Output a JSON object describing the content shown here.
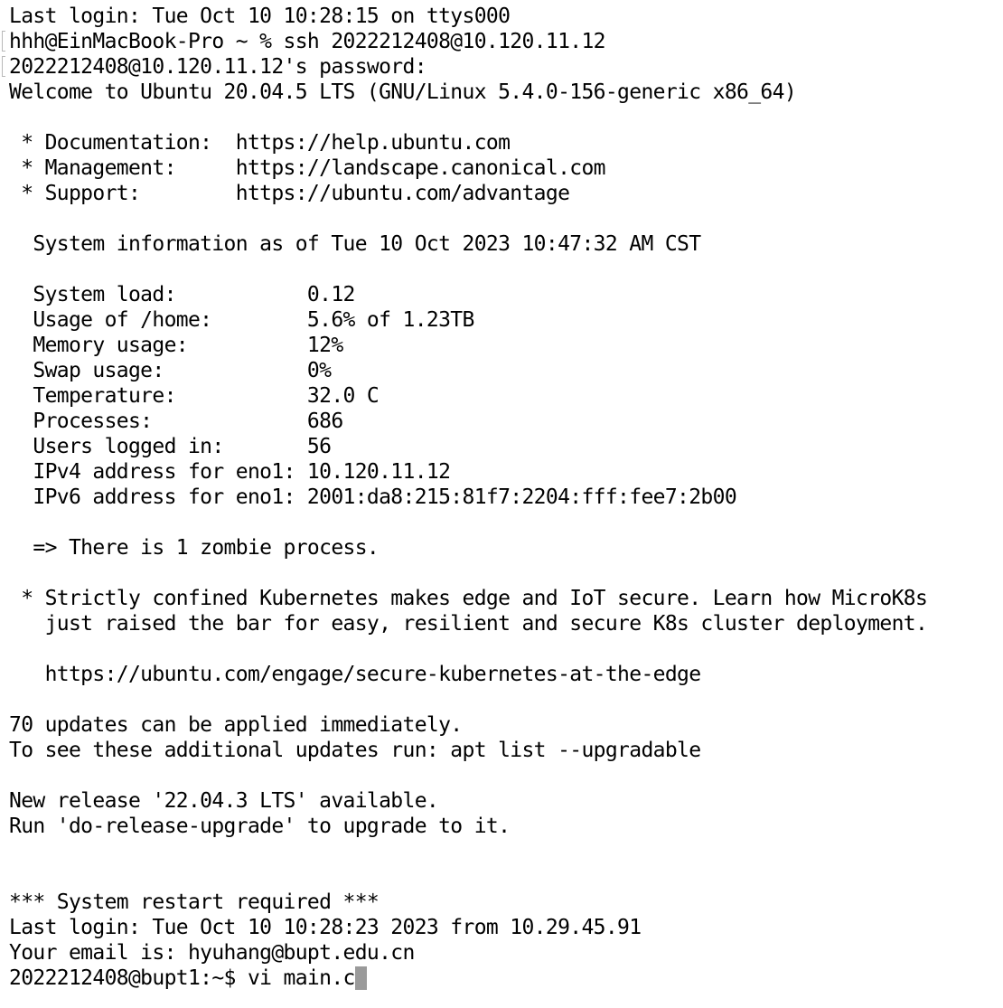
{
  "terminal": {
    "lines": [
      "Last login: Tue Oct 10 10:28:15 on ttys000",
      "hhh@EinMacBook-Pro ~ % ssh 2022212408@10.120.11.12",
      "2022212408@10.120.11.12's password:",
      "Welcome to Ubuntu 20.04.5 LTS (GNU/Linux 5.4.0-156-generic x86_64)",
      "",
      " * Documentation:  https://help.ubuntu.com",
      " * Management:     https://landscape.canonical.com",
      " * Support:        https://ubuntu.com/advantage",
      "",
      "  System information as of Tue 10 Oct 2023 10:47:32 AM CST",
      "",
      "  System load:           0.12",
      "  Usage of /home:        5.6% of 1.23TB",
      "  Memory usage:          12%",
      "  Swap usage:            0%",
      "  Temperature:           32.0 C",
      "  Processes:             686",
      "  Users logged in:       56",
      "  IPv4 address for eno1: 10.120.11.12",
      "  IPv6 address for eno1: 2001:da8:215:81f7:2204:fff:fee7:2b00",
      "",
      "  => There is 1 zombie process.",
      "",
      " * Strictly confined Kubernetes makes edge and IoT secure. Learn how MicroK8s",
      "   just raised the bar for easy, resilient and secure K8s cluster deployment.",
      "",
      "   https://ubuntu.com/engage/secure-kubernetes-at-the-edge",
      "",
      "70 updates can be applied immediately.",
      "To see these additional updates run: apt list --upgradable",
      "",
      "New release '22.04.3 LTS' available.",
      "Run 'do-release-upgrade' to upgrade to it.",
      "",
      "",
      "*** System restart required ***",
      "Last login: Tue Oct 10 10:28:23 2023 from 10.29.45.91",
      "Your email is: hyuhang@bupt.edu.cn",
      "2022212408@bupt1:~$ vi main.c"
    ]
  }
}
